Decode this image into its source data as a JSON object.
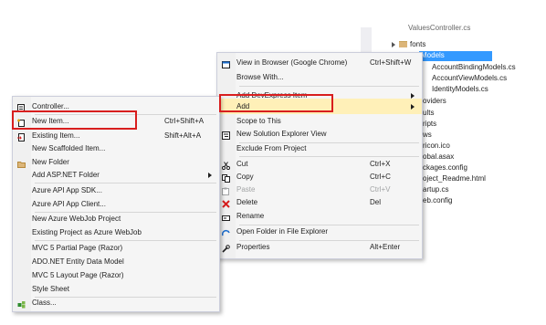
{
  "solution_explorer": {
    "items": [
      {
        "label": "ValuesController.cs"
      },
      {
        "label": "fonts"
      },
      {
        "label": "Models"
      },
      {
        "label": "AccountBindingModels.cs"
      },
      {
        "label": "AccountViewModels.cs"
      },
      {
        "label": "IdentityModels.cs"
      },
      {
        "label": "oviders"
      },
      {
        "label": "ults"
      },
      {
        "label": "ripts"
      },
      {
        "label": "ws"
      },
      {
        "label": "ricon.ico"
      },
      {
        "label": "obal.asax"
      },
      {
        "label": "ckages.config"
      },
      {
        "label": "oject_Readme.html"
      },
      {
        "label": "artup.cs"
      },
      {
        "label": "eb.config"
      }
    ]
  },
  "context_menu": {
    "items": [
      {
        "label": "View in Browser (Google Chrome)",
        "shortcut": "Ctrl+Shift+W",
        "icon": "browser-icon"
      },
      {
        "label": "Browse With..."
      },
      {
        "label": "Add DevExpress Item",
        "submenu": true
      },
      {
        "label": "Add",
        "submenu": true,
        "highlighted": true
      },
      {
        "label": "Scope to This"
      },
      {
        "label": "New Solution Explorer View",
        "icon": "solution-explorer-icon"
      },
      {
        "label": "Exclude From Project"
      },
      {
        "label": "Cut",
        "shortcut": "Ctrl+X",
        "icon": "scissors-icon"
      },
      {
        "label": "Copy",
        "shortcut": "Ctrl+C",
        "icon": "copy-icon"
      },
      {
        "label": "Paste",
        "shortcut": "Ctrl+V",
        "icon": "paste-icon",
        "disabled": true
      },
      {
        "label": "Delete",
        "shortcut": "Del",
        "icon": "delete-icon"
      },
      {
        "label": "Rename",
        "icon": "rename-icon"
      },
      {
        "label": "Open Folder in File Explorer",
        "icon": "open-folder-icon"
      },
      {
        "label": "Properties",
        "shortcut": "Alt+Enter",
        "icon": "wrench-icon"
      }
    ]
  },
  "add_submenu": {
    "items": [
      {
        "label": "Controller...",
        "icon": "controller-icon"
      },
      {
        "label": "New Item...",
        "shortcut": "Ctrl+Shift+A",
        "icon": "new-item-icon"
      },
      {
        "label": "Existing Item...",
        "shortcut": "Shift+Alt+A",
        "icon": "existing-item-icon"
      },
      {
        "label": "New Scaffolded Item..."
      },
      {
        "label": "New Folder",
        "icon": "new-folder-icon"
      },
      {
        "label": "Add ASP.NET Folder",
        "submenu": true
      },
      {
        "label": "Azure API App SDK..."
      },
      {
        "label": "Azure API App Client..."
      },
      {
        "label": "New Azure WebJob Project"
      },
      {
        "label": "Existing Project as Azure WebJob"
      },
      {
        "label": "MVC 5 Partial Page (Razor)"
      },
      {
        "label": "ADO.NET Entity Data Model"
      },
      {
        "label": "MVC 5 Layout Page (Razor)"
      },
      {
        "label": "Style Sheet"
      },
      {
        "label": "Class...",
        "icon": "class-icon"
      }
    ]
  },
  "colors": {
    "highlight": "#fff0b8",
    "callout": "#d81e1e",
    "selection": "#3399ff"
  }
}
